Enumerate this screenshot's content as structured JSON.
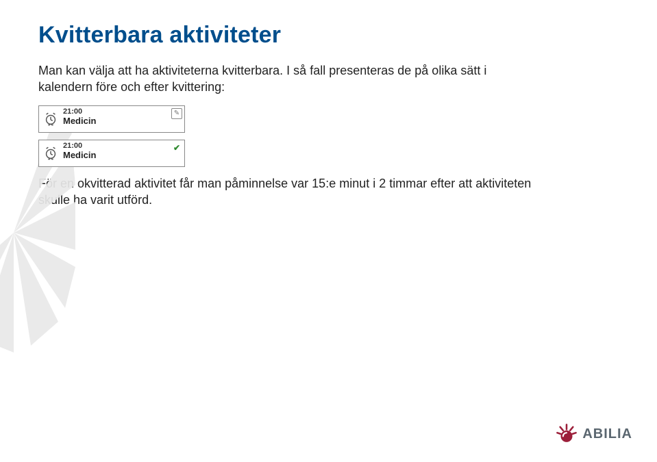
{
  "title": "Kvitterbara aktiviteter",
  "paragraph1": "Man kan välja att ha aktiviteterna kvitterbara. I så fall presenteras de på olika sätt i kalendern före och efter kvittering:",
  "activity": {
    "before": {
      "time": "21:00",
      "label": "Medicin",
      "status": "pending"
    },
    "after": {
      "time": "21:00",
      "label": "Medicin",
      "status": "done"
    }
  },
  "paragraph2": "För en okvitterad aktivitet får man påminnelse var 15:e minut i 2 timmar efter att aktiviteten skulle ha varit utförd.",
  "brand": "ABILIA",
  "colors": {
    "title": "#004e8c",
    "accent": "#9c1f3a"
  }
}
